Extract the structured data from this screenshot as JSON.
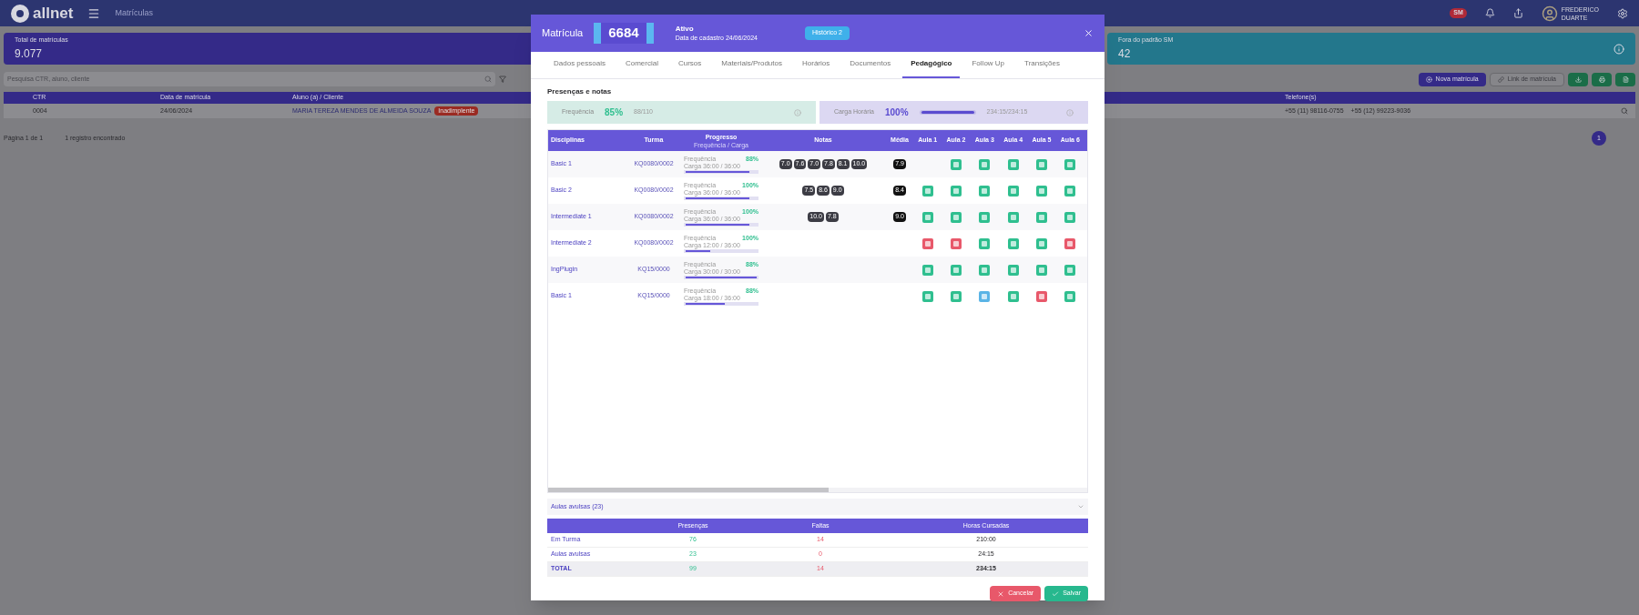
{
  "app": {
    "logo": "allnet",
    "page_title": "Matrículas",
    "user": {
      "name": "FREDERICO",
      "surname": "DUARTE"
    },
    "flag_badge": "SM"
  },
  "stats": [
    {
      "label": "Total de matrículas",
      "value": "9.077",
      "color": "#342a88"
    },
    {
      "label": "Fora do padrão SM",
      "value": "42",
      "color": "#23778c"
    }
  ],
  "search": {
    "placeholder": "Pesquisa CTR, aluno, cliente"
  },
  "actions": [
    {
      "label": "Nova matrícula",
      "kind": "primary"
    },
    {
      "label": "Link de matrícula",
      "kind": "outline"
    },
    {
      "kind": "icon"
    },
    {
      "kind": "icon"
    },
    {
      "kind": "icon"
    }
  ],
  "list": {
    "columns": [
      "CTR",
      "Data de matrícula",
      "Aluno (a) / Cliente",
      "Telefone(s)"
    ],
    "rows": [
      {
        "ctr": "0004",
        "date": "24/06/2024",
        "name": "MARIA TEREZA MENDES DE ALMEIDA SOUZA",
        "badge": "Inadimplente",
        "phones": [
          "+55 (11) 98116-0755",
          "+55 (12) 99223-9036"
        ]
      }
    ]
  },
  "pagination": {
    "page": "Página 1 de 1",
    "count": "1 registro encontrado",
    "current": "1"
  },
  "modal": {
    "title": "Matrícula",
    "number": "6684",
    "status": "Ativo",
    "status_detail": "Data de cadastro 24/06/2024",
    "badge": "Histórico 2",
    "tabs": [
      {
        "label": "Dados pessoais",
        "selected": false
      },
      {
        "label": "Comercial",
        "selected": false
      },
      {
        "label": "Cursos",
        "selected": false
      },
      {
        "label": "Materiais/Produtos",
        "selected": false
      },
      {
        "label": "Horários",
        "selected": false
      },
      {
        "label": "Documentos",
        "selected": false
      },
      {
        "label": "Pedagógico",
        "selected": true
      },
      {
        "label": "Follow Up",
        "selected": false
      },
      {
        "label": "Transições",
        "selected": false
      }
    ],
    "section_title": "Presenças e notas",
    "summary_cards": [
      {
        "label": "Frequência",
        "value": "85%",
        "detail": "88/110",
        "kind": "frequency"
      },
      {
        "label": "Carga Horária",
        "value": "100%",
        "detail": "234:15/234:15",
        "kind": "workload",
        "level": 1
      }
    ],
    "grades": {
      "columns": [
        "Disciplinas",
        "Turma",
        "Progresso",
        "Notas",
        "Média",
        "Aula 1",
        "Aula 2",
        "Aula 3",
        "Aula 4",
        "Aula 5",
        "Aula 6"
      ],
      "progress_subtitle": "Frequência / Carga",
      "rows": [
        {
          "discipline": "Basic 1",
          "class": "KQ0080/0002",
          "freq_label": "Frequência",
          "freq": "88%",
          "load": "Carga 36:00 / 36:00",
          "level": 0.9,
          "grades": [
            "7.0",
            "7.6",
            "7.0",
            "7.8",
            "8.1",
            "10.0"
          ],
          "average": "7.9",
          "lessons": [
            {
              "kind": "none"
            },
            {
              "kind": "present"
            },
            {
              "kind": "present"
            },
            {
              "kind": "present"
            },
            {
              "kind": "present"
            },
            {
              "kind": "present"
            }
          ]
        },
        {
          "discipline": "Basic 2",
          "class": "KQ0080/0002",
          "freq_label": "Frequência",
          "freq": "100%",
          "load": "Carga 36:00 / 36:00",
          "level": 0.9,
          "grades": [
            "7.5",
            "8.6",
            "9.0"
          ],
          "average": "8.4",
          "lessons": [
            {
              "kind": "present"
            },
            {
              "kind": "present"
            },
            {
              "kind": "present"
            },
            {
              "kind": "present"
            },
            {
              "kind": "present"
            },
            {
              "kind": "present"
            }
          ]
        },
        {
          "discipline": "Intermediate 1",
          "class": "KQ0080/0002",
          "freq_label": "Frequência",
          "freq": "100%",
          "load": "Carga 36:00 / 36:00",
          "level": 0.9,
          "grades": [
            "10.0",
            "7.8"
          ],
          "average": "9.0",
          "lessons": [
            {
              "kind": "present"
            },
            {
              "kind": "present"
            },
            {
              "kind": "present"
            },
            {
              "kind": "present"
            },
            {
              "kind": "present"
            },
            {
              "kind": "present"
            }
          ]
        },
        {
          "discipline": "Intermediate 2",
          "class": "KQ0080/0002",
          "freq_label": "Frequência",
          "freq": "100%",
          "load": "Carga 12:00 / 36:00",
          "level": 0.35,
          "grades": [],
          "lessons": [
            {
              "kind": "absent"
            },
            {
              "kind": "absent"
            },
            {
              "kind": "present"
            },
            {
              "kind": "present"
            },
            {
              "kind": "present"
            },
            {
              "kind": "absent"
            }
          ]
        },
        {
          "discipline": "IngPlugin",
          "class": "KQ15/0000",
          "freq_label": "Frequência",
          "freq": "88%",
          "load": "Carga 30:00 / 30:00",
          "level": 1,
          "grades": [],
          "lessons": [
            {
              "kind": "present"
            },
            {
              "kind": "present"
            },
            {
              "kind": "present"
            },
            {
              "kind": "present"
            },
            {
              "kind": "present"
            },
            {
              "kind": "present"
            }
          ]
        },
        {
          "discipline": "Basic 1",
          "class": "KQ15/0000",
          "freq_label": "Frequência",
          "freq": "88%",
          "load": "Carga 18:00 / 36:00",
          "level": 0.55,
          "grades": [],
          "lessons": [
            {
              "kind": "present"
            },
            {
              "kind": "present"
            },
            {
              "kind": "replacement"
            },
            {
              "kind": "present"
            },
            {
              "kind": "absent"
            },
            {
              "kind": "present"
            }
          ]
        }
      ]
    },
    "accordion": {
      "label": "Aulas avulsas (23)",
      "expanded": false
    },
    "totals": {
      "columns": [
        "Presenças",
        "Faltas",
        "Horas Cursadas"
      ],
      "rows": [
        {
          "label": "Em Turma",
          "presences": "76",
          "absences": "14",
          "hours": "210:00",
          "kind": "normal"
        },
        {
          "label": "Aulas avulsas",
          "presences": "23",
          "absences": "0",
          "hours": "24:15",
          "kind": "normal"
        },
        {
          "label": "TOTAL",
          "presences": "99",
          "absences": "14",
          "hours": "234:15",
          "kind": "total"
        }
      ]
    },
    "buttons": [
      {
        "label": "Cancelar",
        "kind": "cancel"
      },
      {
        "label": "Salvar",
        "kind": "save"
      }
    ]
  }
}
